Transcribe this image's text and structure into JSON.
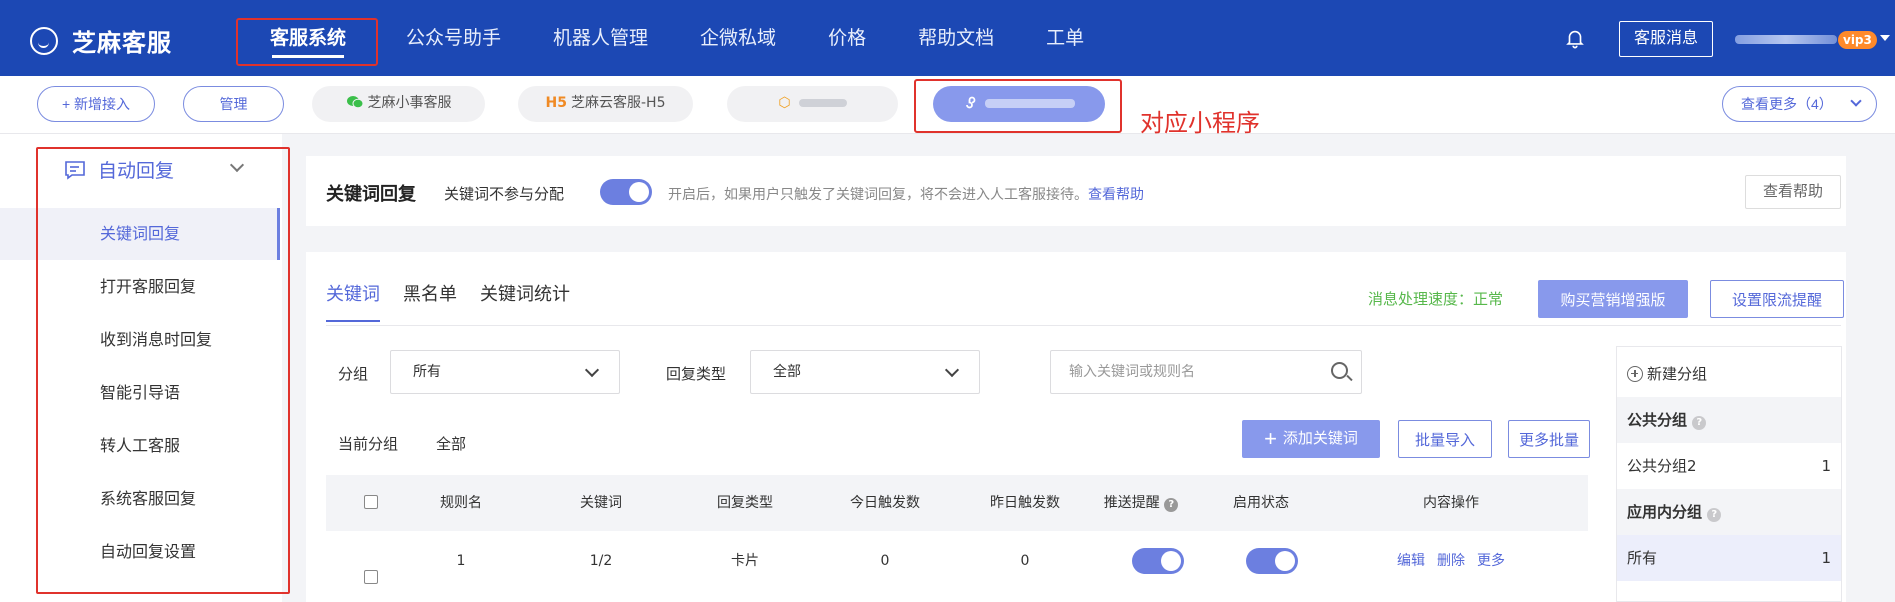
{
  "app": {
    "title": "芝麻客服",
    "nav": [
      "客服系统",
      "公众号助手",
      "机器人管理",
      "企微私域",
      "价格",
      "帮助文档",
      "工单"
    ],
    "message_button": "客服消息",
    "vip_badge": "vip3"
  },
  "channels": {
    "add": "+ 新增接入",
    "manage": "管理",
    "items": [
      "芝麻小事客服",
      "芝麻云客服-H5"
    ],
    "h5_prefix": "H5",
    "see_more": "查看更多（4）",
    "annotation": "对应小程序"
  },
  "sidebar": {
    "header": "自动回复",
    "items": [
      "关键词回复",
      "打开客服回复",
      "收到消息时回复",
      "智能引导语",
      "转人工客服",
      "系统客服回复",
      "自动回复设置"
    ]
  },
  "keyword_panel": {
    "title": "关键词回复",
    "toggle_label": "关键词不参与分配",
    "hint": "开启后，如果用户只触发了关键词回复，将不会进入人工客服接待。",
    "hint_link": "查看帮助",
    "help_button": "查看帮助"
  },
  "tabs": [
    "关键词",
    "黑名单",
    "关键词统计"
  ],
  "status": {
    "speed": "消息处理速度：正常",
    "buy_button": "购买营销增强版",
    "limit_button": "设置限流提醒"
  },
  "filters": {
    "group_label": "分组",
    "group_value": "所有",
    "type_label": "回复类型",
    "type_value": "全部",
    "search_placeholder": "输入关键词或规则名"
  },
  "current_group": {
    "label": "当前分组",
    "value": "全部"
  },
  "actions": {
    "add": "添加关键词",
    "import": "批量导入",
    "more": "更多批量"
  },
  "table": {
    "columns": [
      "规则名",
      "关键词",
      "回复类型",
      "今日触发数",
      "昨日触发数",
      "推送提醒",
      "启用状态",
      "内容操作"
    ],
    "rows": [
      {
        "rule": "1",
        "keyword": "1/2",
        "type": "卡片",
        "today": "0",
        "yesterday": "0",
        "push": true,
        "enabled": true
      }
    ],
    "ops": [
      "编辑",
      "删除",
      "更多"
    ]
  },
  "groups": {
    "new": "新建分组",
    "public_header": "公共分组",
    "public_items": [
      {
        "name": "公共分组2",
        "count": "1"
      }
    ],
    "app_header": "应用内分组",
    "app_items": [
      {
        "name": "所有",
        "count": "1"
      }
    ]
  },
  "colors": {
    "nav_bg": "#1c48b4",
    "accent": "#5468d9",
    "button_fill": "#8899ec",
    "annotation": "#e0322c",
    "status_ok": "#57b84b"
  }
}
